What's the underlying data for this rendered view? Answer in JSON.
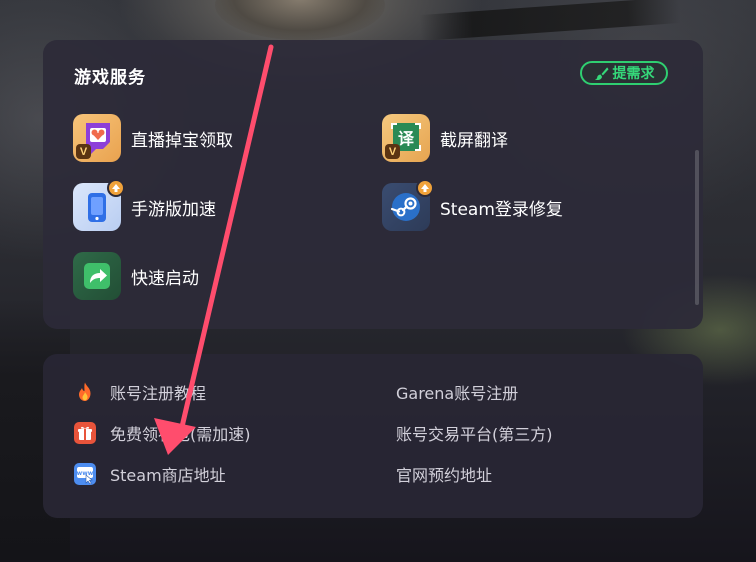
{
  "services_panel": {
    "title": "游戏服务",
    "request_button": "提需求",
    "items": [
      {
        "label": "直播掉宝领取",
        "icon": "twitch-drops-icon",
        "vip_badge": "V"
      },
      {
        "label": "截屏翻译",
        "icon": "screenshot-translate-icon",
        "vip_badge": "V"
      },
      {
        "label": "手游版加速",
        "icon": "mobile-accelerate-icon"
      },
      {
        "label": "Steam登录修复",
        "icon": "steam-icon"
      },
      {
        "label": "快速启动",
        "icon": "quick-launch-icon"
      }
    ],
    "icon_glyph_translate": "译"
  },
  "links_panel": {
    "left": [
      {
        "label": "账号注册教程",
        "icon": "fire-icon"
      },
      {
        "label": "免费领礼包(需加速)",
        "icon": "gift-icon"
      },
      {
        "label": "Steam商店地址",
        "icon": "www-icon"
      }
    ],
    "right": [
      {
        "label": "Garena账号注册"
      },
      {
        "label": "账号交易平台(第三方)"
      },
      {
        "label": "官网预约地址"
      }
    ],
    "www_glyph": "www"
  },
  "colors": {
    "accent_green": "#35d97a",
    "annotation_arrow": "#ff4d6d",
    "panel_bg": "#2c2a38"
  }
}
